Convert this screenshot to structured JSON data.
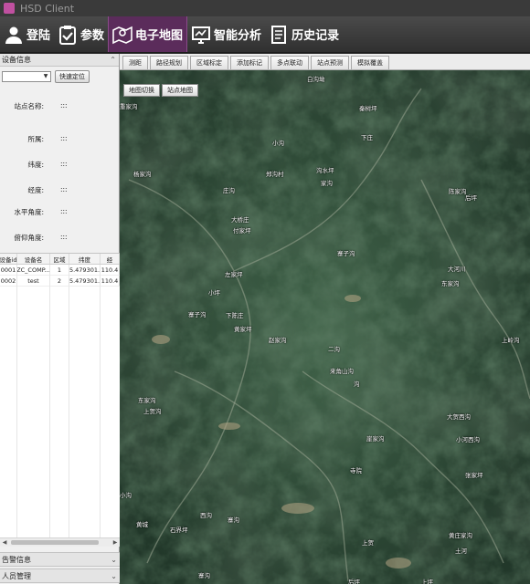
{
  "window": {
    "title": "HSD Client"
  },
  "toolbar": {
    "buttons": [
      {
        "label": "登陆",
        "icon": "user-icon"
      },
      {
        "label": "参数",
        "icon": "clipboard-check-icon"
      },
      {
        "label": "电子地图",
        "icon": "map-pin-icon",
        "active": true
      },
      {
        "label": "智能分析",
        "icon": "monitor-analysis-icon"
      },
      {
        "label": "历史记录",
        "icon": "document-list-icon"
      }
    ]
  },
  "left_panel": {
    "device_info_title": "设备信息",
    "locate_button": "快速定位",
    "selected_device": "",
    "fields": [
      {
        "label": "站点名称:",
        "value": ":::"
      },
      {
        "label": "所属:",
        "value": ":::"
      },
      {
        "label": "纬度:",
        "value": ":::"
      },
      {
        "label": "经度:",
        "value": ":::"
      },
      {
        "label": "水平角度:",
        "value": ":::"
      },
      {
        "label": "俯仰角度:",
        "value": ":::"
      }
    ],
    "table": {
      "headers": [
        "设备id",
        "设备名",
        "区域",
        "纬度",
        "经"
      ],
      "rows": [
        [
          "0001",
          "ZC_COMP...",
          "1",
          "35.479301...",
          "110.4"
        ],
        [
          "0002",
          "test",
          "2",
          "35.479301...",
          "110.4"
        ]
      ]
    },
    "bottom_sections": [
      "告警信息",
      "人员管理"
    ]
  },
  "map": {
    "tabs": [
      "测距",
      "路径规划",
      "区域标定",
      "添加标记",
      "多点联动",
      "站点预测",
      "模拟覆盖"
    ],
    "buttons": [
      "地图切换",
      "站点地图"
    ],
    "places": [
      {
        "name": "白沟坳"
      },
      {
        "name": "重家沟"
      },
      {
        "name": "秦树坪"
      },
      {
        "name": "小沟"
      },
      {
        "name": "下庄"
      },
      {
        "name": "杨家沟"
      },
      {
        "name": "郑沟村"
      },
      {
        "name": "沟水坪"
      },
      {
        "name": "家沟"
      },
      {
        "name": "庄沟"
      },
      {
        "name": "大桥庄"
      },
      {
        "name": "付家坪"
      },
      {
        "name": "陈家沟"
      },
      {
        "name": "后坪"
      },
      {
        "name": "寨子沟"
      },
      {
        "name": "大河川"
      },
      {
        "name": "东家沟"
      },
      {
        "name": "左家坪"
      },
      {
        "name": "小坪"
      },
      {
        "name": "下陈庄"
      },
      {
        "name": "寨子沟"
      },
      {
        "name": "黄家坪"
      },
      {
        "name": "赵家沟"
      },
      {
        "name": "上岭沟"
      },
      {
        "name": "二沟"
      },
      {
        "name": "来角山沟"
      },
      {
        "name": "沟"
      },
      {
        "name": "大贺西沟"
      },
      {
        "name": "东家沟"
      },
      {
        "name": "上贺沟"
      },
      {
        "name": "崖家沟"
      },
      {
        "name": "小河西沟"
      },
      {
        "name": "寺院"
      },
      {
        "name": "张家坪"
      },
      {
        "name": "小沟"
      },
      {
        "name": "黄城"
      },
      {
        "name": "西沟"
      },
      {
        "name": "寨沟"
      },
      {
        "name": "石界坪"
      },
      {
        "name": "上贺"
      },
      {
        "name": "黄庄家沟"
      },
      {
        "name": "土河"
      },
      {
        "name": "寨沟"
      },
      {
        "name": "后坪"
      },
      {
        "name": "上坪"
      }
    ]
  }
}
